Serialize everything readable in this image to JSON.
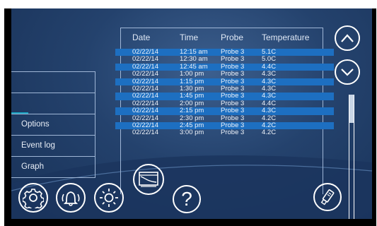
{
  "menu": {
    "items": [
      {
        "label": ""
      },
      {
        "label": ""
      },
      {
        "label": "Options"
      },
      {
        "label": "Event log"
      },
      {
        "label": "Graph"
      }
    ]
  },
  "table": {
    "headers": [
      "Date",
      "Time",
      "Probe",
      "Temperature"
    ],
    "rows": [
      {
        "date": "02/22/14",
        "time": "12:15 am",
        "probe": "Probe 3",
        "temp": "5.1C",
        "highlight": true
      },
      {
        "date": "02/22/14",
        "time": "12:30 am",
        "probe": "Probe 3",
        "temp": "5.0C",
        "highlight": false
      },
      {
        "date": "02/22/14",
        "time": "12:45 am",
        "probe": "Probe 3",
        "temp": "4.4C",
        "highlight": true
      },
      {
        "date": "02/22/14",
        "time": "1:00 pm",
        "probe": "Probe 3",
        "temp": "4.3C",
        "highlight": false
      },
      {
        "date": "02/22/14",
        "time": "1:15 pm",
        "probe": "Probe 3",
        "temp": "4.3C",
        "highlight": true
      },
      {
        "date": "02/22/14",
        "time": "1:30 pm",
        "probe": "Probe 3",
        "temp": "4.3C",
        "highlight": false
      },
      {
        "date": "02/22/14",
        "time": "1:45 pm",
        "probe": "Probe 3",
        "temp": "4.3C",
        "highlight": true
      },
      {
        "date": "02/22/14",
        "time": "2:00 pm",
        "probe": "Probe 3",
        "temp": "4.4C",
        "highlight": false
      },
      {
        "date": "02/22/14",
        "time": "2:15 pm",
        "probe": "Probe 3",
        "temp": "4.3C",
        "highlight": true
      },
      {
        "date": "02/22/14",
        "time": "2:30 pm",
        "probe": "Probe 3",
        "temp": "4.2C",
        "highlight": false
      },
      {
        "date": "02/22/14",
        "time": "2:45 pm",
        "probe": "Probe 3",
        "temp": "4.2C",
        "highlight": true
      },
      {
        "date": "02/22/14",
        "time": "3:00 pm",
        "probe": "Probe 3",
        "temp": "4.2C",
        "highlight": false
      }
    ]
  },
  "toolbar": {
    "icons": [
      "gear-icon",
      "alarm-bell-icon",
      "brightness-icon",
      "graph-window-icon",
      "help-icon",
      "usb-drive-icon"
    ],
    "help_label": "?"
  },
  "scroll": {
    "up_icon": "chevron-up-icon",
    "down_icon": "chevron-down-icon"
  },
  "colors": {
    "background": "#24426d",
    "highlight": "#1d6fc1",
    "accent": "#1aa6c4",
    "foreground": "#ffffff"
  }
}
